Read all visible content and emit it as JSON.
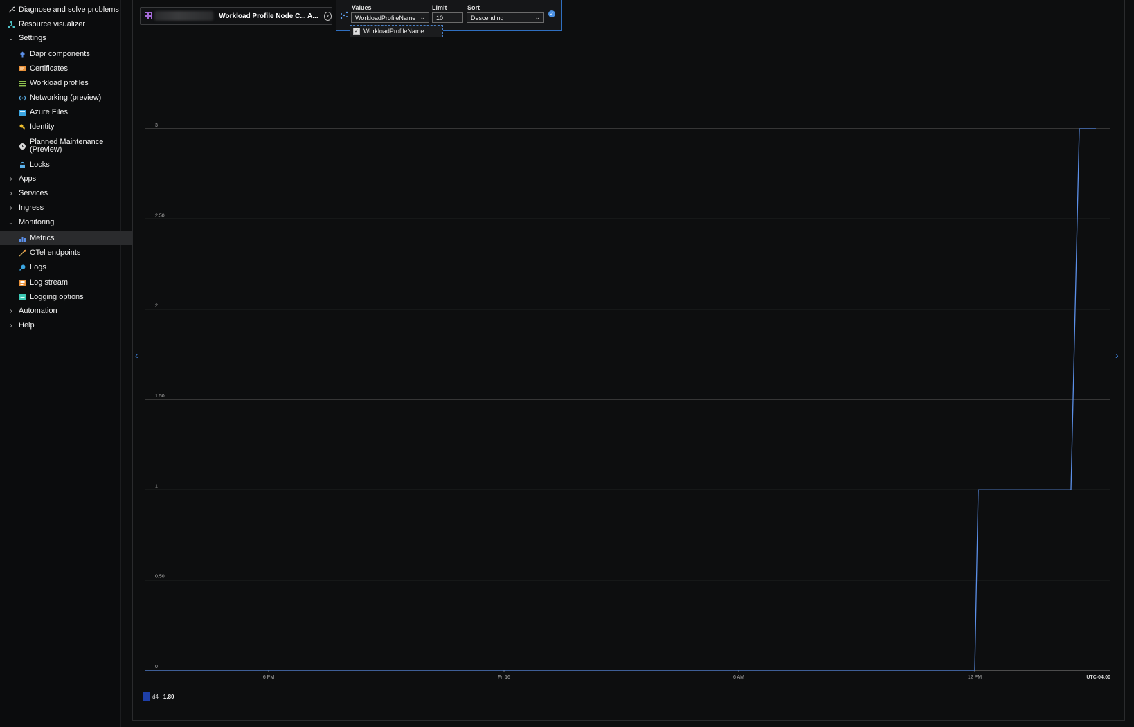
{
  "sidebar": {
    "items": [
      {
        "label": "Diagnose and solve problems",
        "icon": "wrench-icon"
      },
      {
        "label": "Resource visualizer",
        "icon": "network-icon"
      },
      {
        "label": "Settings",
        "chevron": "expanded"
      },
      {
        "label": "Dapr components",
        "icon": "dapr-icon"
      },
      {
        "label": "Certificates",
        "icon": "certificate-icon"
      },
      {
        "label": "Workload profiles",
        "icon": "list-icon"
      },
      {
        "label": "Networking (preview)",
        "icon": "networking-icon"
      },
      {
        "label": "Azure Files",
        "icon": "files-icon"
      },
      {
        "label": "Identity",
        "icon": "key-icon"
      },
      {
        "label": "Planned Maintenance (Preview)",
        "icon": "clock-icon"
      },
      {
        "label": "Locks",
        "icon": "lock-icon"
      },
      {
        "label": "Apps",
        "chevron": "collapsed"
      },
      {
        "label": "Services",
        "chevron": "collapsed"
      },
      {
        "label": "Ingress",
        "chevron": "collapsed"
      },
      {
        "label": "Monitoring",
        "chevron": "expanded"
      },
      {
        "label": "Metrics",
        "icon": "metrics-icon",
        "selected": true
      },
      {
        "label": "OTel endpoints",
        "icon": "pipeline-icon"
      },
      {
        "label": "Logs",
        "icon": "logs-icon"
      },
      {
        "label": "Log stream",
        "icon": "log-stream-icon"
      },
      {
        "label": "Logging options",
        "icon": "logging-options-icon"
      },
      {
        "label": "Automation",
        "chevron": "collapsed"
      },
      {
        "label": "Help",
        "chevron": "collapsed"
      }
    ]
  },
  "metric_pill": {
    "name": "Workload Profile Node C... A..."
  },
  "split": {
    "values_label": "Values",
    "values_value": "WorkloadProfileName",
    "limit_label": "Limit",
    "limit_value": "10",
    "sort_label": "Sort",
    "sort_value": "Descending",
    "option_label": "WorkloadProfileName"
  },
  "colors": {
    "accent": "#3e7fd6",
    "series": "#5b8fe8",
    "legend_swatch": "#1e3fa8"
  },
  "chart_data": {
    "type": "line",
    "title": "",
    "ylim": [
      0,
      3
    ],
    "y_ticks": [
      "0",
      "0.50",
      "1",
      "1.50",
      "2",
      "2.50",
      "3"
    ],
    "x_ticks": [
      "6 PM",
      "Fri 16",
      "6 AM",
      "12 PM"
    ],
    "timezone": "UTC-04:00",
    "grid": true,
    "series": [
      {
        "name": "d4",
        "summary": "1.80",
        "x": [
          "6 PM",
          "Fri 16",
          "6 AM",
          "12 PM",
          "12 PM",
          "3 PM",
          "3 PM",
          "3:30 PM"
        ],
        "values": [
          0,
          0,
          0,
          0,
          1,
          1,
          3,
          3
        ]
      }
    ]
  }
}
